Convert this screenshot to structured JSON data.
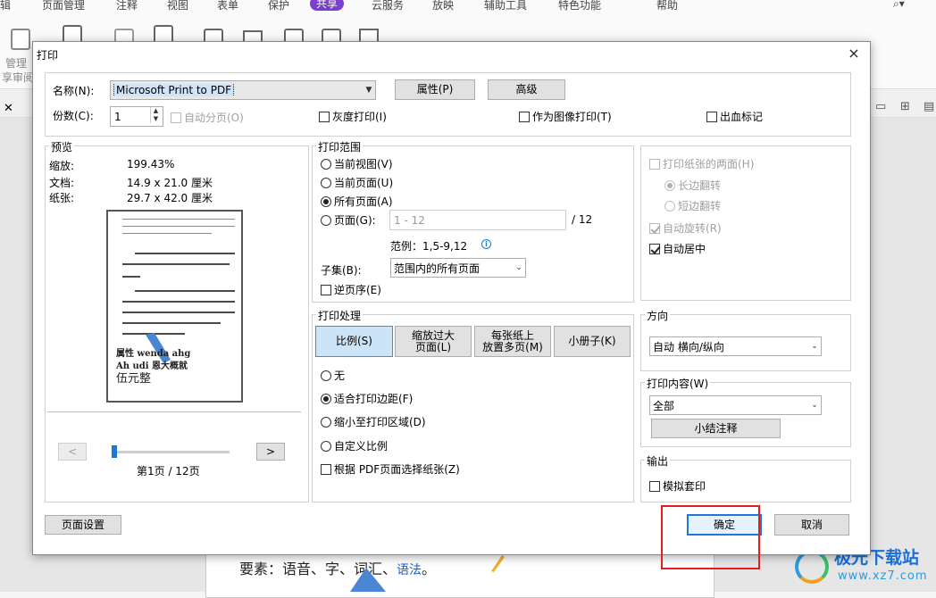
{
  "app": {
    "menu": [
      "辑",
      "页面管理",
      "注释",
      "视图",
      "表单",
      "保护",
      "共享",
      "云服务",
      "放映",
      "辅助工具",
      "特色功能",
      "帮助"
    ],
    "active_menu": "共享",
    "ribbon_labels": [
      "管理",
      "享审阅"
    ],
    "doc_text": "要素：语音、字",
    "doc_text_2": "、词汇、",
    "doc_text_blue": "语法",
    "doc_text_end": "。"
  },
  "dialog": {
    "title": "打印",
    "close": "×",
    "printer": {
      "name_label": "名称(N):",
      "name_value": "Microsoft Print to PDF",
      "properties_btn": "属性(P)",
      "advanced_btn": "高级",
      "copies_label": "份数(C):",
      "copies_value": "1",
      "collate_label": "自动分页(O)",
      "grayscale_label": "灰度打印(I)",
      "as_image_label": "作为图像打印(T)",
      "bleed_label": "出血标记"
    },
    "preview": {
      "title": "预览",
      "zoom_label": "缩放:",
      "zoom_value": "199.43%",
      "doc_label": "文档:",
      "doc_value": "14.9 x 21.0 厘米",
      "paper_label": "纸张:",
      "paper_value": "29.7 x 42.0 厘米",
      "sample_line1": "属性 wenda ahg",
      "sample_line2": "Ah udi 恩大概就",
      "sample_line3": "伍元整",
      "prev": "<",
      "next": ">",
      "page_indicator": "第1页 / 12页",
      "page_fraction": 0.0
    },
    "range": {
      "title": "打印范围",
      "current_view": "当前视图(V)",
      "current_page": "当前页面(U)",
      "all_pages": "所有页面(A)",
      "pages": "页面(G):",
      "pages_placeholder": "1 - 12",
      "pages_total": "/ 12",
      "example": "范例：1,5-9,12",
      "subset_label": "子集(B):",
      "subset_value": "范围内的所有页面",
      "reverse": "逆页序(E)"
    },
    "duplex": {
      "both_sides": "打印纸张的两面(H)",
      "long_edge": "长边翻转",
      "short_edge": "短边翻转",
      "auto_rotate": "自动旋转(R)",
      "auto_center": "自动居中"
    },
    "handling": {
      "title": "打印处理",
      "tabs": [
        "比例(S)",
        "缩放过大\n页面(L)",
        "每张纸上\n放置多页(M)",
        "小册子(K)"
      ],
      "none": "无",
      "fit_margins": "适合打印边距(F)",
      "shrink": "缩小至打印区域(D)",
      "custom": "自定义比例",
      "choose_paper": "根据 PDF页面选择纸张(Z)"
    },
    "orientation": {
      "title": "方向",
      "value": "自动 横向/纵向"
    },
    "content": {
      "title": "打印内容(W)",
      "value": "全部",
      "summary_btn": "小结注释"
    },
    "output": {
      "title": "输出",
      "simulate": "模拟套印"
    },
    "page_setup_btn": "页面设置",
    "ok_btn": "确定",
    "cancel_btn": "取消"
  },
  "watermark": {
    "title": "极光下载站",
    "sub": "www.xz7.com"
  },
  "colors": {
    "accent": "#1e78d7",
    "highlight": "#e02020",
    "menu_active": "#7a3fd0"
  }
}
